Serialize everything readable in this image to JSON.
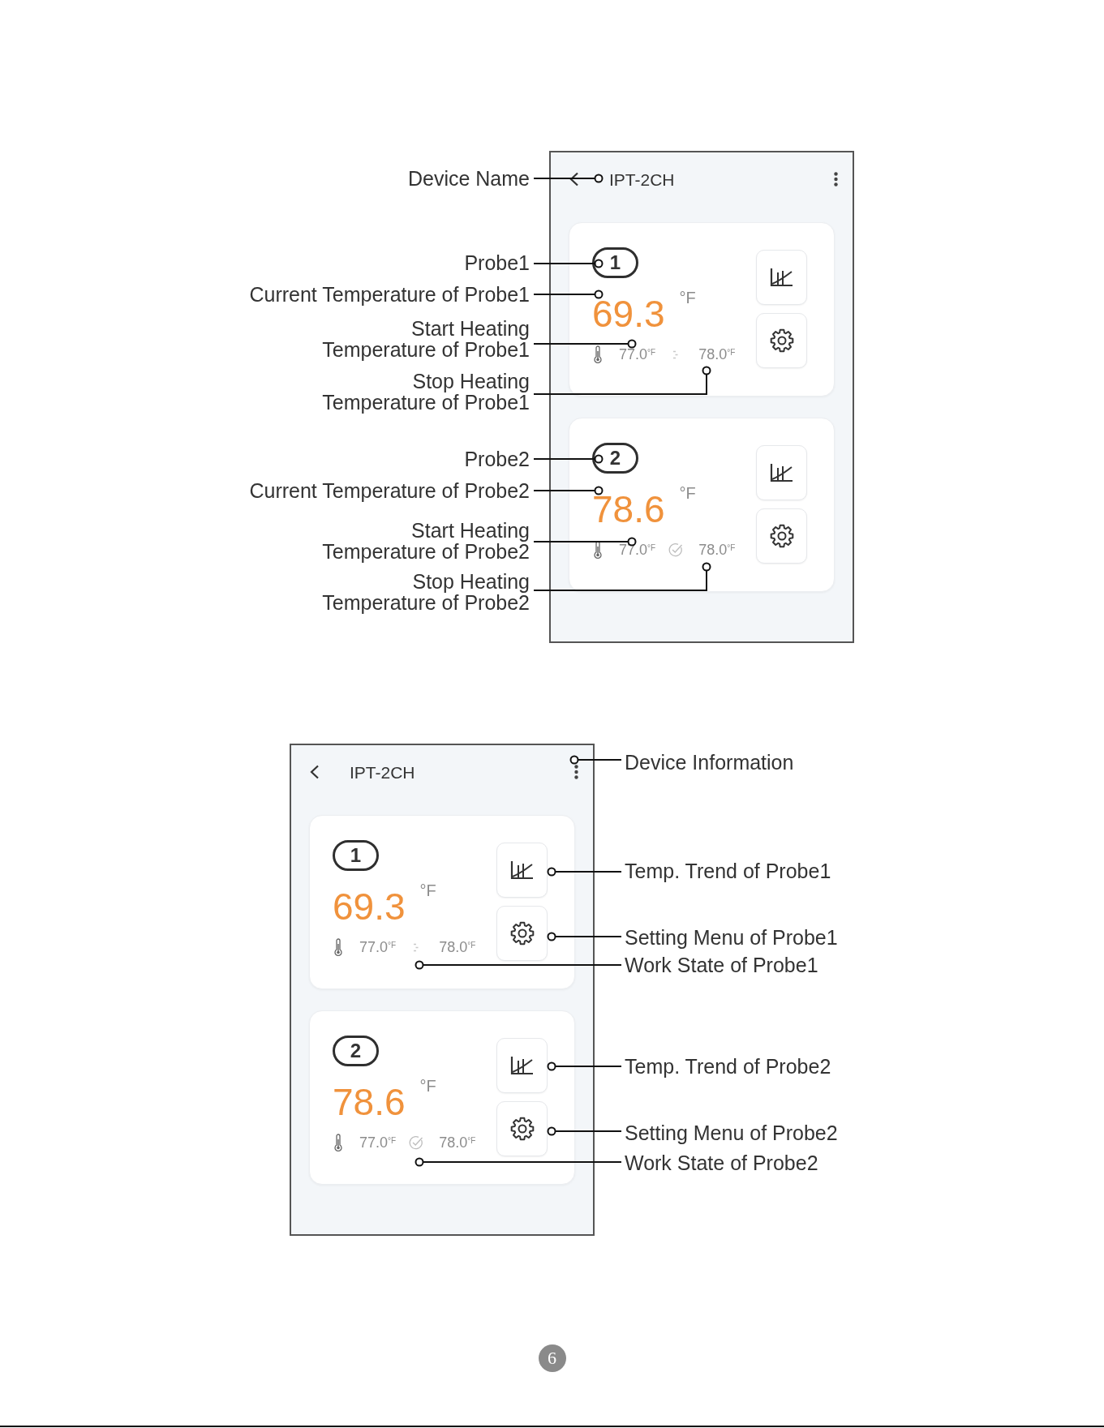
{
  "figures": [
    {
      "screen": {
        "title": "IPT-2CH",
        "probes": [
          {
            "number": "1",
            "temperature": "69.3",
            "unit": "°F",
            "start_temp": "77.0$^{°F}$",
            "heating": true,
            "stop_temp": "78.0$^{°F}$"
          },
          {
            "number": "2",
            "temperature": "78.6",
            "unit": "°F",
            "start_temp": "77.0$^{°F}$",
            "heating": false,
            "stop_temp": "78.0$^{°F}$"
          }
        ]
      },
      "callouts": [
        {
          "text": "Device Name"
        },
        {
          "text": "Probe1"
        },
        {
          "text": "Current Temperature of Probe1"
        },
        {
          "text": "Start Heating\nTemperature of Probe1"
        },
        {
          "text": "Stop Heating\nTemperature of Probe1"
        },
        {
          "text": "Probe2"
        },
        {
          "text": "Current Temperature of Probe2"
        },
        {
          "text": "Start Heating\nTemperature of Probe2"
        },
        {
          "text": "Stop Heating\nTemperature of Probe2"
        }
      ]
    },
    {
      "screen": {
        "title": "IPT-2CH",
        "probes": [
          {
            "number": "1",
            "temperature": "69.3",
            "unit": "°F",
            "start_temp": "77.0$^{°F}$",
            "heating": true,
            "stop_temp": "78.0$^{°F}$"
          },
          {
            "number": "2",
            "temperature": "78.6",
            "unit": "°F",
            "start_temp": "77.0$^{°F}$",
            "heating": false,
            "stop_temp": "78.0$^{°F}$"
          }
        ]
      },
      "callouts": [
        {
          "text": "Device Information"
        },
        {
          "text": "Temp. Trend of Probe1"
        },
        {
          "text": "Setting Menu of Probe1"
        },
        {
          "text": "Work State of Probe1"
        },
        {
          "text": "Temp. Trend of Probe2"
        },
        {
          "text": "Setting Menu of Probe2"
        },
        {
          "text": "Work State of Probe2"
        }
      ]
    }
  ],
  "page_number": "6"
}
